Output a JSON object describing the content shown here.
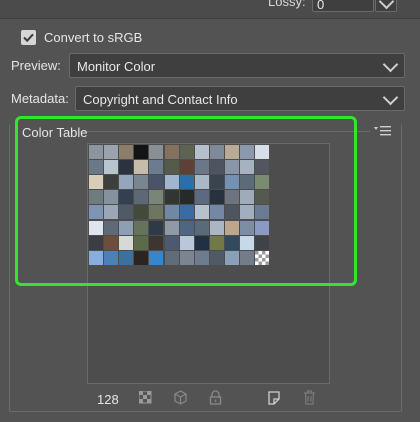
{
  "lossy": {
    "label": "Lossy:",
    "value": "0"
  },
  "convert_srgb": {
    "label": "Convert to sRGB",
    "checked": true
  },
  "preview": {
    "label": "Preview:",
    "value": "Monitor Color"
  },
  "metadata": {
    "label": "Metadata:",
    "value": "Copyright and Contact Info"
  },
  "color_table": {
    "title": "Color Table",
    "count": "128",
    "highlight_color": "#33e62a",
    "rows": [
      [
        "#8d96a0",
        "#9aa3ad",
        "#8b7d6a",
        "#121416",
        "#8a8f95",
        "#85715f",
        "#5e6251",
        "#b5c0cc",
        "#7e8a9a",
        "#b8aa95",
        "#8a99ab",
        "#d6dee8"
      ],
      [
        "#6a7888",
        "#b9c4d1",
        "#2b3340",
        "#c7bcaa",
        "#6d7b90",
        "#555b4a",
        "#5f4036",
        "#6b7686",
        "#4d5560",
        "#8896a8",
        "#a7b2c0",
        "#51575c"
      ],
      [
        "#d8cdb6",
        "#3d3f3c",
        "#93a6bb",
        "#7a8592",
        "#4a5468",
        "#a0b6cf",
        "#2c6ea6",
        "#a9b7c6",
        "#3a444f",
        "#7491b3",
        "#5d6a78",
        "#7a8b70"
      ],
      [
        "#6f7b7e",
        "#85919c",
        "#344051",
        "#5d6877",
        "#7b8479",
        "#313730",
        "#262a28",
        "#5b6a80",
        "#28323e",
        "#6d7480",
        "#9eabb8",
        "#545b4e"
      ],
      [
        "#7d95b3",
        "#9aa7b6",
        "#4f5a66",
        "#424a39",
        "#6e765f",
        "#7188a4",
        "#3b6ba3",
        "#b7c1cc",
        "#7288a6",
        "#4e5561",
        "#a1aec0",
        "#6a7c93"
      ],
      [
        "#dfe5ec",
        "#606a77",
        "#8e9fb5",
        "#66735a",
        "#2f3a47",
        "#8f9aa6",
        "#4f6581",
        "#5b6a79",
        "#aab6c3",
        "#bea68e",
        "#7b8ea6",
        "#8b9ac2"
      ],
      [
        "#3b3d42",
        "#6b4f3a",
        "#d7d9d6",
        "#5d6a47",
        "#3d3630",
        "#4c5a6f",
        "#b8c8da",
        "#213143",
        "#727848",
        "#34485f",
        "#c7d8ea",
        "#3f4247"
      ],
      [
        "#88aee0",
        "#4e80b8",
        "#3d6f9f",
        "#2a2521",
        "#3686cf",
        "#626c78",
        "#7b8591",
        "#6d7d8f",
        "#4f5a69",
        "#8aa0b9",
        "#727d89",
        "transparent"
      ]
    ]
  }
}
